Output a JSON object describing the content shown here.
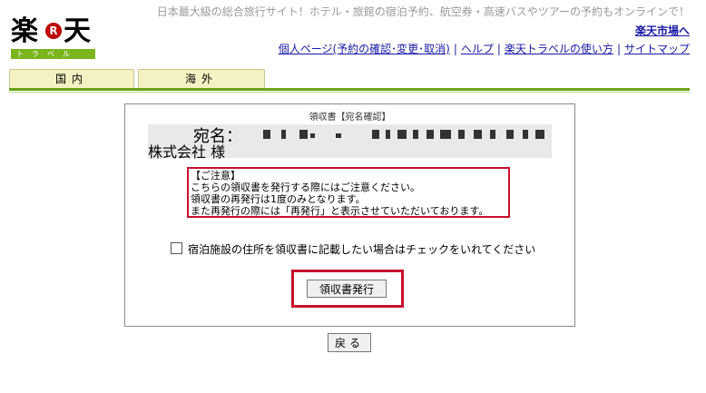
{
  "logo": {
    "kanji_1": "楽",
    "r_mark": "R",
    "kanji_2": "天",
    "sub": "トラベル"
  },
  "header": {
    "tagline": "日本最大級の総合旅行サイト！ホテル・旅館の宿泊予約、航空券・高速バスやツアーの予約もオンラインで！",
    "market_link": "楽天市場へ",
    "nav": [
      {
        "label": "個人ページ(予約の確認･変更･取消)"
      },
      {
        "label": "ヘルプ"
      },
      {
        "label": "楽天トラベルの使い方"
      },
      {
        "label": "サイトマップ"
      }
    ],
    "separator": "|"
  },
  "tabs": [
    {
      "label": "国内"
    },
    {
      "label": "海外"
    }
  ],
  "panel": {
    "title": "領収書【宛名確認】",
    "addressee_label": "宛名：",
    "addressee_company": "株式会社 様",
    "notice_lines": [
      "【ご注意】",
      "こちらの領収書を発行する際にはご注意ください。",
      "領収書の再発行は1度のみとなります。",
      "また再発行の際には「再発行」と表示させていただいております。"
    ],
    "checkbox_label": "宿泊施設の住所を領収書に記載したい場合はチェックをいれてください",
    "checkbox_checked": false,
    "issue_button": "領収書発行"
  },
  "back_button": "戻る",
  "colors": {
    "accent_red": "#c8102e",
    "brand_green": "#6aa31a",
    "link_blue": "#1a1aa6",
    "tab_bg": "#f4f1c2"
  }
}
